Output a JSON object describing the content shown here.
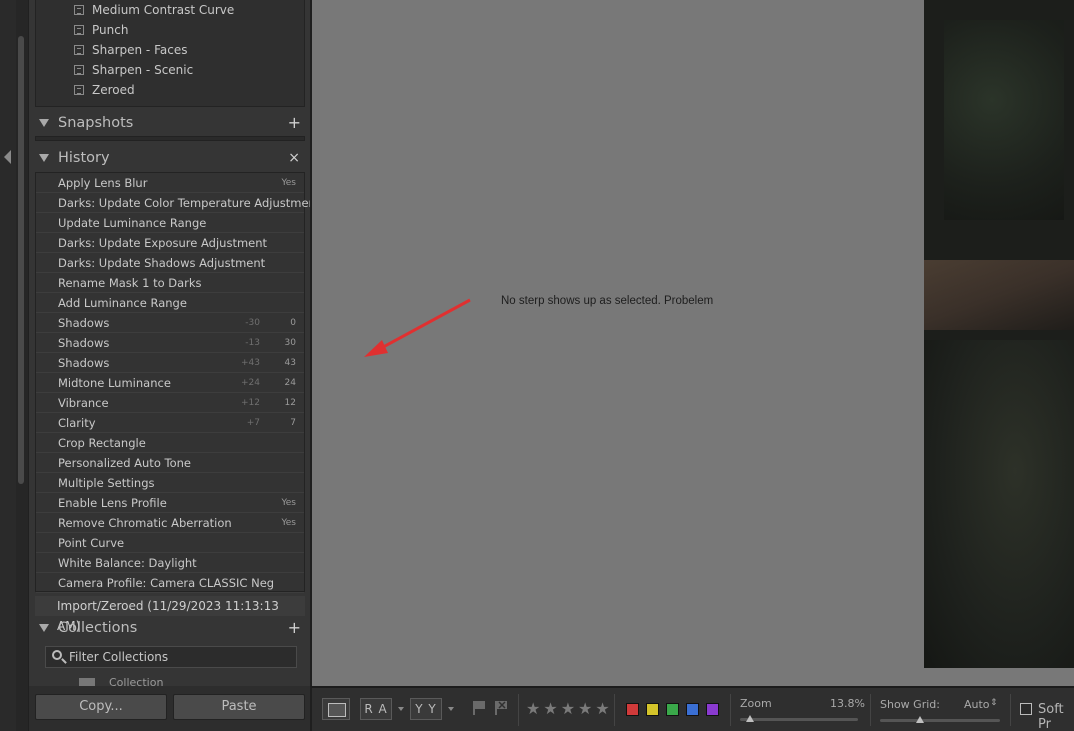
{
  "presets": [
    "Medium Contrast Curve",
    "Punch",
    "Sharpen - Faces",
    "Sharpen - Scenic",
    "Zeroed"
  ],
  "snapshots": {
    "title": "Snapshots",
    "add": "+"
  },
  "history": {
    "title": "History",
    "clear": "×",
    "items": [
      {
        "name": "Apply Lens Blur",
        "v1": "",
        "v2": "Yes"
      },
      {
        "name": "Darks: Update Color Temperature Adjustment",
        "v1": "",
        "v2": ""
      },
      {
        "name": "Update Luminance Range",
        "v1": "",
        "v2": ""
      },
      {
        "name": "Darks: Update Exposure Adjustment",
        "v1": "",
        "v2": ""
      },
      {
        "name": "Darks: Update Shadows Adjustment",
        "v1": "",
        "v2": ""
      },
      {
        "name": "Rename Mask 1 to Darks",
        "v1": "",
        "v2": ""
      },
      {
        "name": "Add Luminance Range",
        "v1": "",
        "v2": ""
      },
      {
        "name": "Shadows",
        "v1": "-30",
        "v2": "0"
      },
      {
        "name": "Shadows",
        "v1": "-13",
        "v2": "30"
      },
      {
        "name": "Shadows",
        "v1": "+43",
        "v2": "43"
      },
      {
        "name": "Midtone Luminance",
        "v1": "+24",
        "v2": "24"
      },
      {
        "name": "Vibrance",
        "v1": "+12",
        "v2": "12"
      },
      {
        "name": "Clarity",
        "v1": "+7",
        "v2": "7"
      },
      {
        "name": "Crop Rectangle",
        "v1": "",
        "v2": ""
      },
      {
        "name": "Personalized Auto Tone",
        "v1": "",
        "v2": ""
      },
      {
        "name": "Multiple Settings",
        "v1": "",
        "v2": ""
      },
      {
        "name": "Enable Lens Profile",
        "v1": "",
        "v2": "Yes"
      },
      {
        "name": "Remove Chromatic Aberration",
        "v1": "",
        "v2": "Yes"
      },
      {
        "name": "Point Curve",
        "v1": "",
        "v2": ""
      },
      {
        "name": "White Balance: Daylight",
        "v1": "",
        "v2": ""
      },
      {
        "name": "Camera Profile: Camera CLASSIC Neg",
        "v1": "",
        "v2": ""
      }
    ],
    "import_item": "Import/Zeroed (11/29/2023 11:13:13 AM)"
  },
  "collections": {
    "title": "Collections",
    "add": "+",
    "filter_placeholder": "Filter Collections",
    "partial_item": "Collection Set"
  },
  "buttons": {
    "copy": "Copy...",
    "paste": "Paste"
  },
  "annotation": "No sterp shows up as selected.  Probelem",
  "annotation_arrow_color": "#e03030",
  "toolbar": {
    "ra": "R A",
    "yy": "Y Y",
    "stars": "★★★★★",
    "colors": [
      "#d03a3a",
      "#d4c42a",
      "#3aa84a",
      "#3a6fd4",
      "#8a3ad0"
    ],
    "zoom_label": "Zoom",
    "zoom_value": "13.8%",
    "grid_label": "Show Grid:",
    "grid_value": "Auto",
    "soft_proof": "Soft Pr"
  }
}
